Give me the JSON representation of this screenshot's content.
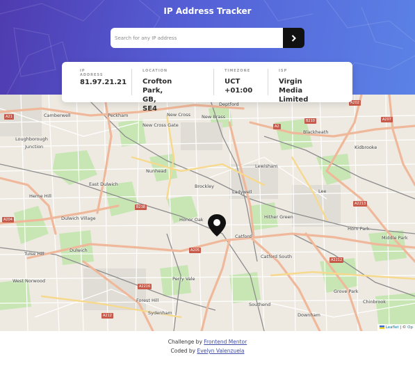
{
  "header": {
    "title": "IP Address Tracker",
    "search_placeholder": "Search for any IP address",
    "search_button_icon": "chevron-right-icon"
  },
  "info": {
    "ip": {
      "label": "IP ADDRESS",
      "value": "81.97.21.21"
    },
    "location": {
      "label": "LOCATION",
      "line1": "Crofton Park,",
      "line2": "GB, SE4"
    },
    "timezone": {
      "label": "TIMEZONE",
      "line1": "UCT",
      "line2": "+01:00"
    },
    "isp": {
      "label": "ISP",
      "line1": "Virgin Media",
      "line2": "Limited"
    }
  },
  "map": {
    "places": {
      "camberwell": "Camberwell",
      "peckham": "Peckham",
      "new_cross": "New Cross",
      "new_cross_gate": "New Cross Gate",
      "deptford": "Deptford",
      "new_brass": "New Brass",
      "loughborough": "Loughborough",
      "junction": "Junction",
      "nunhead": "Nunhead",
      "lewisham": "Lewisham",
      "blackheath": "Blackheath",
      "kidbrooke": "Kidbrooke",
      "east_dulwich": "East Dulwich",
      "brockley": "Brockley",
      "ladywell": "Ladywell",
      "lee": "Lee",
      "herne_hill": "Herne Hill",
      "dulwich_village": "Dulwich Village",
      "honor_oak": "Honor Oak",
      "hither_green": "Hither Green",
      "horn_park": "Horn Park",
      "middle_park": "Middle Park",
      "tulse_hill": "Tulse Hill",
      "dulwich": "Dulwich",
      "catford": "Catford",
      "catford_south": "Catford South",
      "west_norwood": "West Norwood",
      "perry_vale": "Perry Vale",
      "forest_hill": "Forest Hill",
      "grove_park": "Grove Park",
      "chinbrook": "Chinbrook",
      "southend": "Southend",
      "downham": "Downham",
      "sydenham": "Sydenham"
    },
    "roads": {
      "a21": "A21",
      "a2": "A2",
      "b210": "B210",
      "a207": "A207",
      "a202": "A202",
      "b238": "B238",
      "a204": "A204",
      "a205": "A205",
      "a2213": "A2213",
      "a2212": "A2212",
      "a2216": "A2216",
      "a212": "A212"
    },
    "attribution": {
      "leaflet": "Leaflet",
      "sep": " | © ",
      "osm": "Op"
    },
    "marker_icon": "location-pin-icon"
  },
  "footer": {
    "challenge_prefix": "Challenge by ",
    "challenge_link": "Frontend Mentor",
    "coded_prefix": "Coded by ",
    "coded_link": "Evelyn Valenzuela"
  }
}
